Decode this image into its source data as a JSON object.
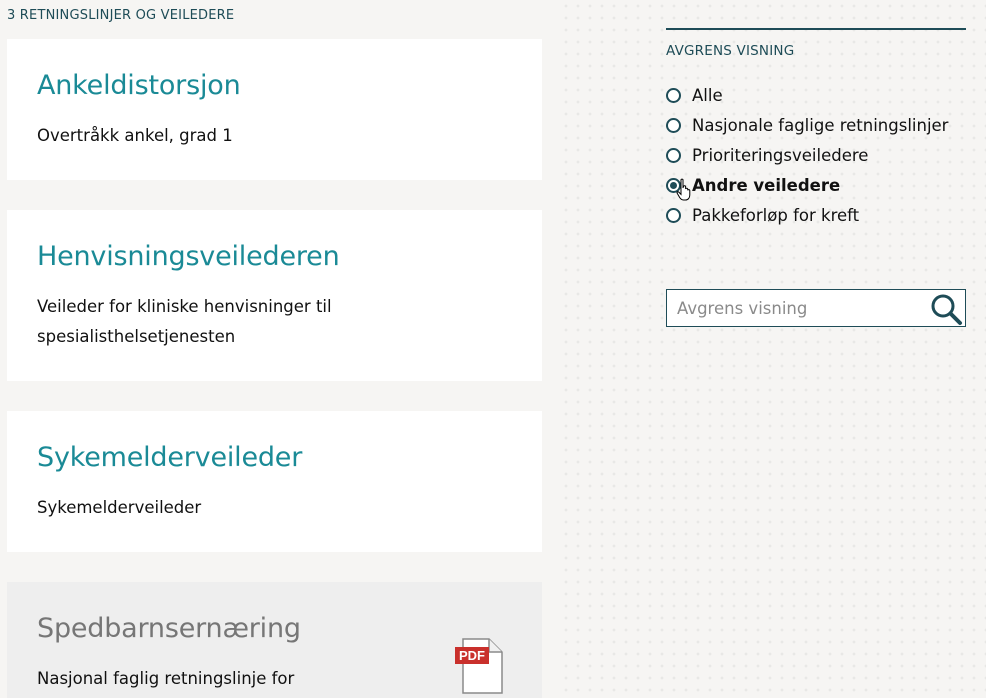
{
  "results": {
    "count_label": "3 RETNINGSLINJER OG VEILEDERE",
    "items": [
      {
        "title": "Ankeldistorsjon",
        "description": "Overtråkk ankel, grad 1"
      },
      {
        "title": "Henvisningsveilederen",
        "description": "Veileder for kliniske henvisninger til spesialisthelsetjenesten"
      },
      {
        "title": "Sykemelderveileder",
        "description": "Sykemelderveileder"
      },
      {
        "title": "Spedbarnsernæring",
        "description": "Nasjonal faglig retningslinje for",
        "badge": "PDF"
      }
    ]
  },
  "filter": {
    "heading": "AVGRENS VISNING",
    "options": [
      {
        "label": "Alle",
        "checked": false
      },
      {
        "label": "Nasjonale faglige retningslinjer",
        "checked": false
      },
      {
        "label": "Prioriteringsveiledere",
        "checked": false
      },
      {
        "label": "Andre veiledere",
        "checked": true
      },
      {
        "label": "Pakkeforløp for kreft",
        "checked": false
      }
    ],
    "search_placeholder": "Avgrens visning"
  },
  "colors": {
    "accent": "#1a8a96",
    "dark": "#1e4c57",
    "pdf_red": "#c9302c"
  }
}
